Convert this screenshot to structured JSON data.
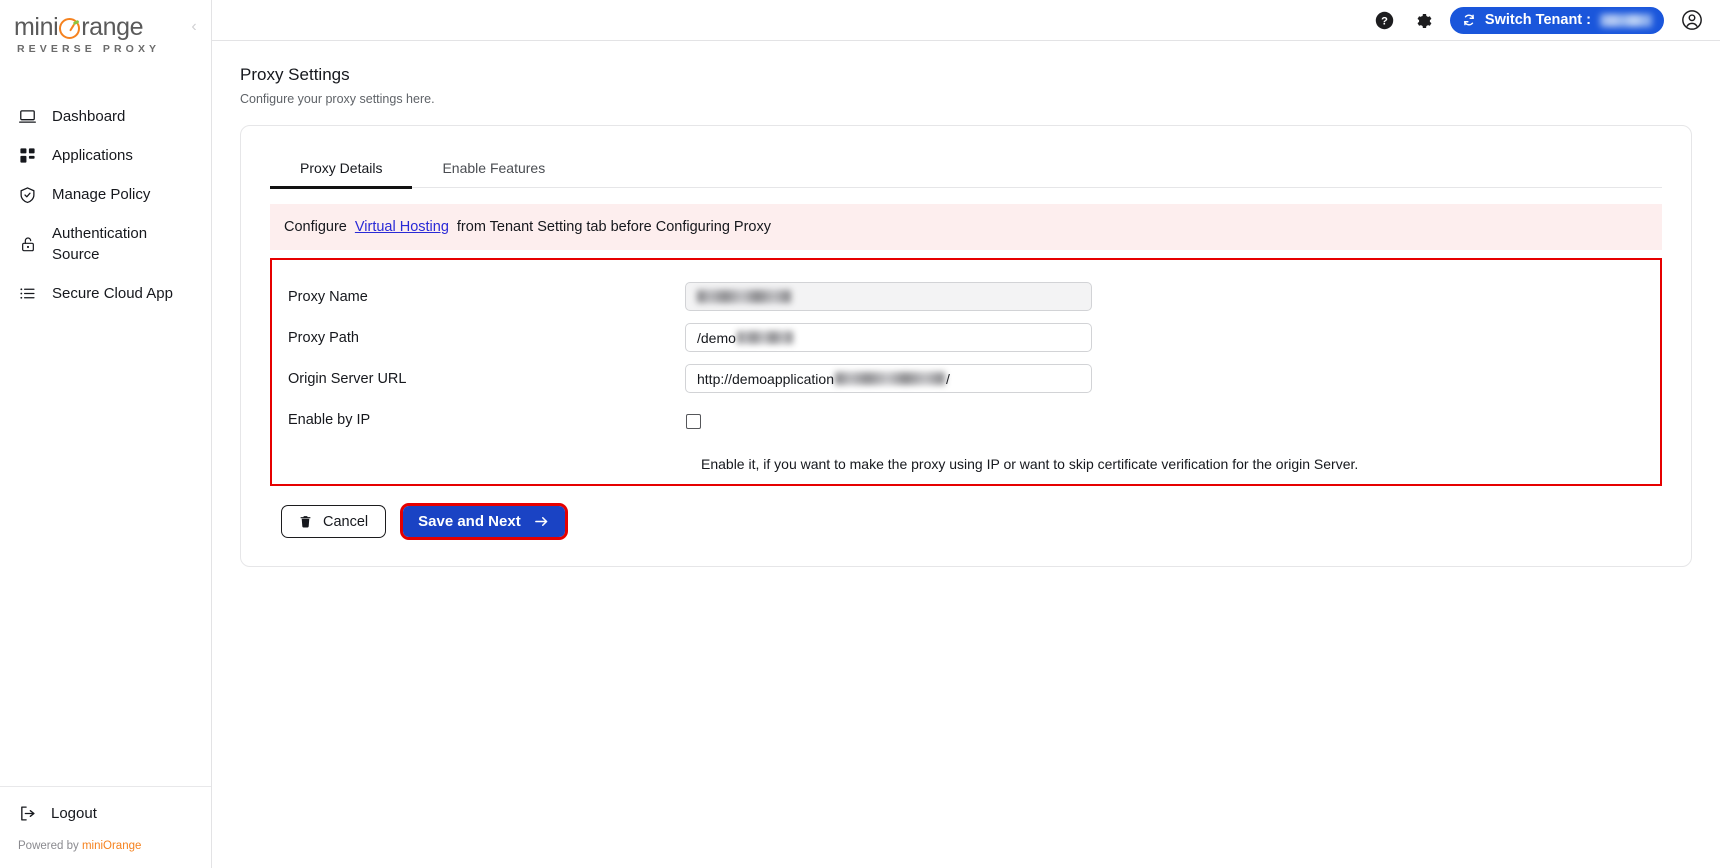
{
  "brand": {
    "name_part1": "mini",
    "name_part2": "range",
    "subtitle": "REVERSE PROXY"
  },
  "sidebar": {
    "items": [
      {
        "label": "Dashboard",
        "icon": "monitor-icon"
      },
      {
        "label": "Applications",
        "icon": "grid-icon"
      },
      {
        "label": "Manage Policy",
        "icon": "shield-check-icon"
      },
      {
        "label": "Authentication Source",
        "icon": "unlock-icon"
      },
      {
        "label": "Secure Cloud App",
        "icon": "list-icon"
      }
    ],
    "logout_label": "Logout",
    "powered_prefix": "Powered by ",
    "powered_brand": "miniOrange"
  },
  "topbar": {
    "help_icon": "help-circle-icon",
    "settings_icon": "gear-icon",
    "switch_tenant_label": "Switch Tenant :",
    "switch_tenant_value": "",
    "account_icon": "user-circle-icon",
    "accent_color": "#1a56db"
  },
  "page": {
    "title": "Proxy Settings",
    "subtitle": "Configure your proxy settings here."
  },
  "tabs": [
    {
      "label": "Proxy Details",
      "active": true
    },
    {
      "label": "Enable Features",
      "active": false
    }
  ],
  "alert": {
    "text_before": "Configure",
    "link_text": "Virtual Hosting",
    "text_after": "from Tenant Setting tab before Configuring Proxy",
    "background": "#fdeeee",
    "link_color": "#2a2ad6"
  },
  "form": {
    "highlight_color": "#e60000",
    "fields": [
      {
        "label": "Proxy Name",
        "value": "",
        "masked": true,
        "type": "text"
      },
      {
        "label": "Proxy Path",
        "value": "/demo",
        "masked": false,
        "type": "text"
      },
      {
        "label": "Origin Server URL",
        "value_prefix": "http://demoapplication",
        "value_suffix": "/",
        "masked": false,
        "type": "text"
      },
      {
        "label": "Enable by IP",
        "checked": false,
        "type": "checkbox"
      }
    ],
    "hint": "Enable it, if you want to make the proxy using IP or want to skip certificate verification for the origin Server."
  },
  "actions": {
    "cancel_label": "Cancel",
    "cancel_icon": "trash-icon",
    "save_label": "Save and Next",
    "save_icon": "arrow-right-icon",
    "save_color": "#1a43c4"
  }
}
